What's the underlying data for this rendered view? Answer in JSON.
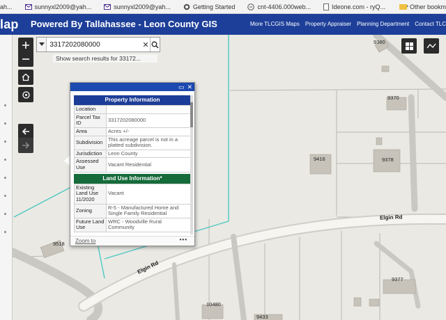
{
  "browser": {
    "bookmarks": [
      {
        "label": "ah...",
        "icon": "mail-icon"
      },
      {
        "label": "sunnyxl2009@yah...",
        "icon": "mail-icon"
      },
      {
        "label": "sunnyxl2009@yah...",
        "icon": "mail-icon"
      },
      {
        "label": "Getting Started",
        "icon": "globe-icon"
      },
      {
        "label": "cnt-4406.000web...",
        "icon": "link-icon"
      },
      {
        "label": "Ideone.com - ryQ...",
        "icon": "page-icon"
      }
    ],
    "other_bookmarks": "Other bookm"
  },
  "app": {
    "left_fragment": "lap",
    "title": "Powered By Tallahassee - Leon County GIS",
    "links": [
      "More TLCGIS Maps",
      "Property Appraiser",
      "Planning Department",
      "Contact TLC"
    ],
    "header_color": "#1d3f99"
  },
  "search": {
    "value": "3317202080000",
    "hint": "Show search results for 33172..."
  },
  "map": {
    "parcel_labels": [
      "9360",
      "9370",
      "9416",
      "9378",
      "9518",
      "9377",
      "10480",
      "9433"
    ],
    "road_label_1": "Elgin Rd",
    "road_label_2": "Elgin Rd"
  },
  "popup": {
    "section_property": "Property Information",
    "section_land_use": "Land Use Information*",
    "zoom_to": "Zoom to",
    "more": "•••",
    "property_rows": [
      {
        "k": "Location",
        "v": ""
      },
      {
        "k": "Parcel Tax ID",
        "v": "3317202080000"
      },
      {
        "k": "Area",
        "v": "Acres +/-"
      },
      {
        "k": "Subdivision",
        "v": "This acreage parcel is not in a platted subdivision."
      },
      {
        "k": "Jurisdiction",
        "v": "Leon County"
      },
      {
        "k": "Assessed Use",
        "v": "Vacant Residential"
      }
    ],
    "land_use_rows": [
      {
        "k": "Existing Land Use 11/2020",
        "v": "Vacant"
      },
      {
        "k": "Zoning",
        "v": "R-5 - Manufactured Home and Single Family Residential"
      },
      {
        "k": "Future Land Use",
        "v": "WRC - Woodville Rural Community"
      }
    ],
    "colors": {
      "blue": "#1c3d97",
      "green": "#156b3a"
    }
  }
}
